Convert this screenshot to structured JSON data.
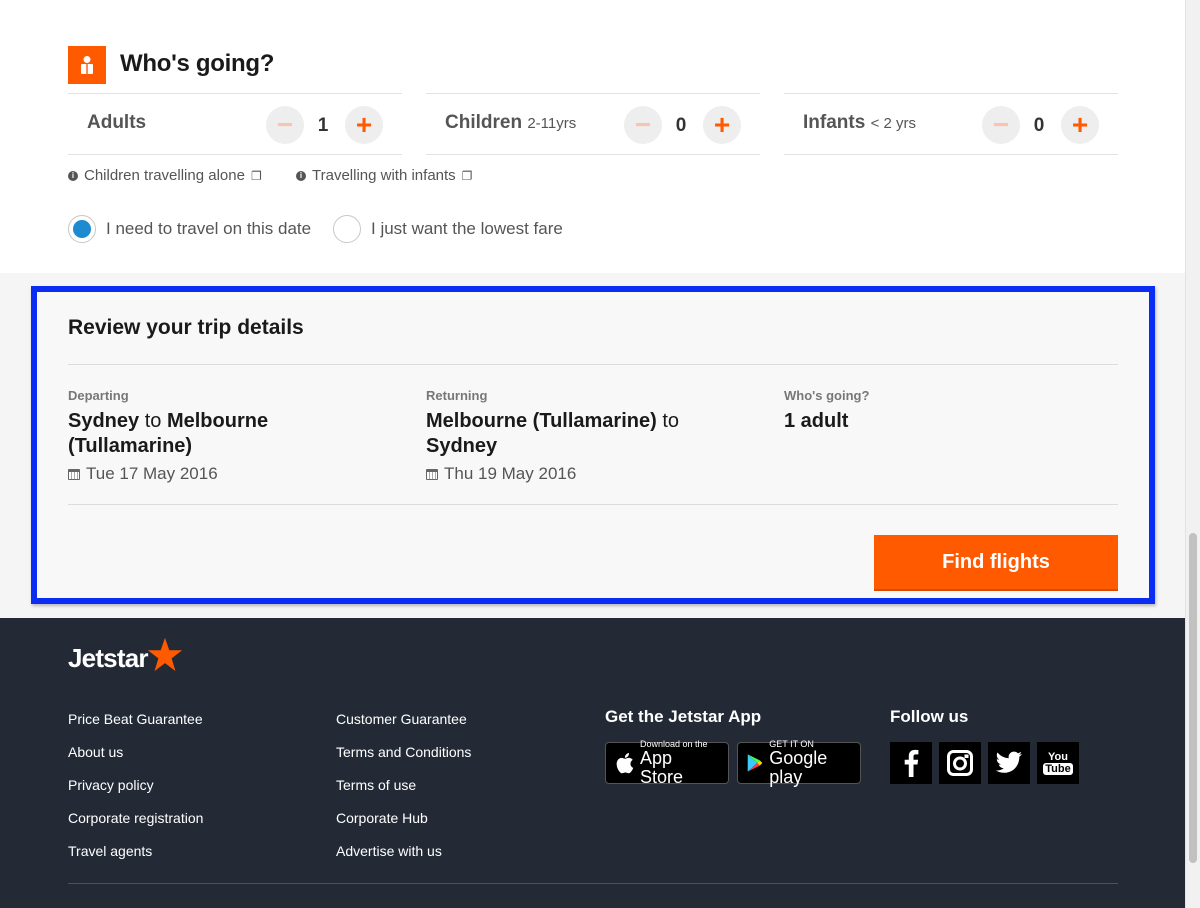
{
  "whos_going": {
    "title": "Who's going?",
    "adults": {
      "label": "Adults",
      "count": "1"
    },
    "children": {
      "label": "Children",
      "sub": "2-11yrs",
      "count": "0"
    },
    "infants": {
      "label": "Infants",
      "sub": "< 2 yrs",
      "count": "0"
    },
    "links": [
      "Children travelling alone",
      "Travelling with infants"
    ],
    "radio_options": [
      {
        "label": "I need to travel on this date",
        "selected": true
      },
      {
        "label": "I just want the lowest fare",
        "selected": false
      }
    ]
  },
  "review": {
    "title": "Review your trip details",
    "departing": {
      "label": "Departing",
      "from": "Sydney",
      "connector": "to",
      "to": "Melbourne (Tullamarine)",
      "date": "Tue 17 May 2016"
    },
    "returning": {
      "label": "Returning",
      "from": "Melbourne (Tullamarine)",
      "connector": "to",
      "to": "Sydney",
      "date": "Thu 19 May 2016"
    },
    "passengers": {
      "label": "Who's going?",
      "value": "1 adult"
    },
    "find_button": "Find flights"
  },
  "footer": {
    "logo": "Jetstar",
    "col1": [
      "Price Beat Guarantee",
      "About us",
      "Privacy policy",
      "Corporate registration",
      "Travel agents"
    ],
    "col2": [
      "Customer Guarantee",
      "Terms and Conditions",
      "Terms of use",
      "Corporate Hub",
      "Advertise with us"
    ],
    "app_heading": "Get the Jetstar App",
    "app_store": {
      "small": "Download on the",
      "big": "App Store"
    },
    "google_play": {
      "small": "GET IT ON",
      "big": "Google play"
    },
    "follow_heading": "Follow us",
    "social_icons": [
      "facebook-icon",
      "instagram-icon",
      "twitter-icon",
      "youtube-icon"
    ],
    "youtube_text": {
      "top": "You",
      "bottom": "Tube"
    }
  },
  "colors": {
    "accent": "#ff5a00",
    "highlight_border": "#0b2cf3",
    "footer_bg": "#232a36",
    "radio_selected": "#1e8bd0"
  }
}
